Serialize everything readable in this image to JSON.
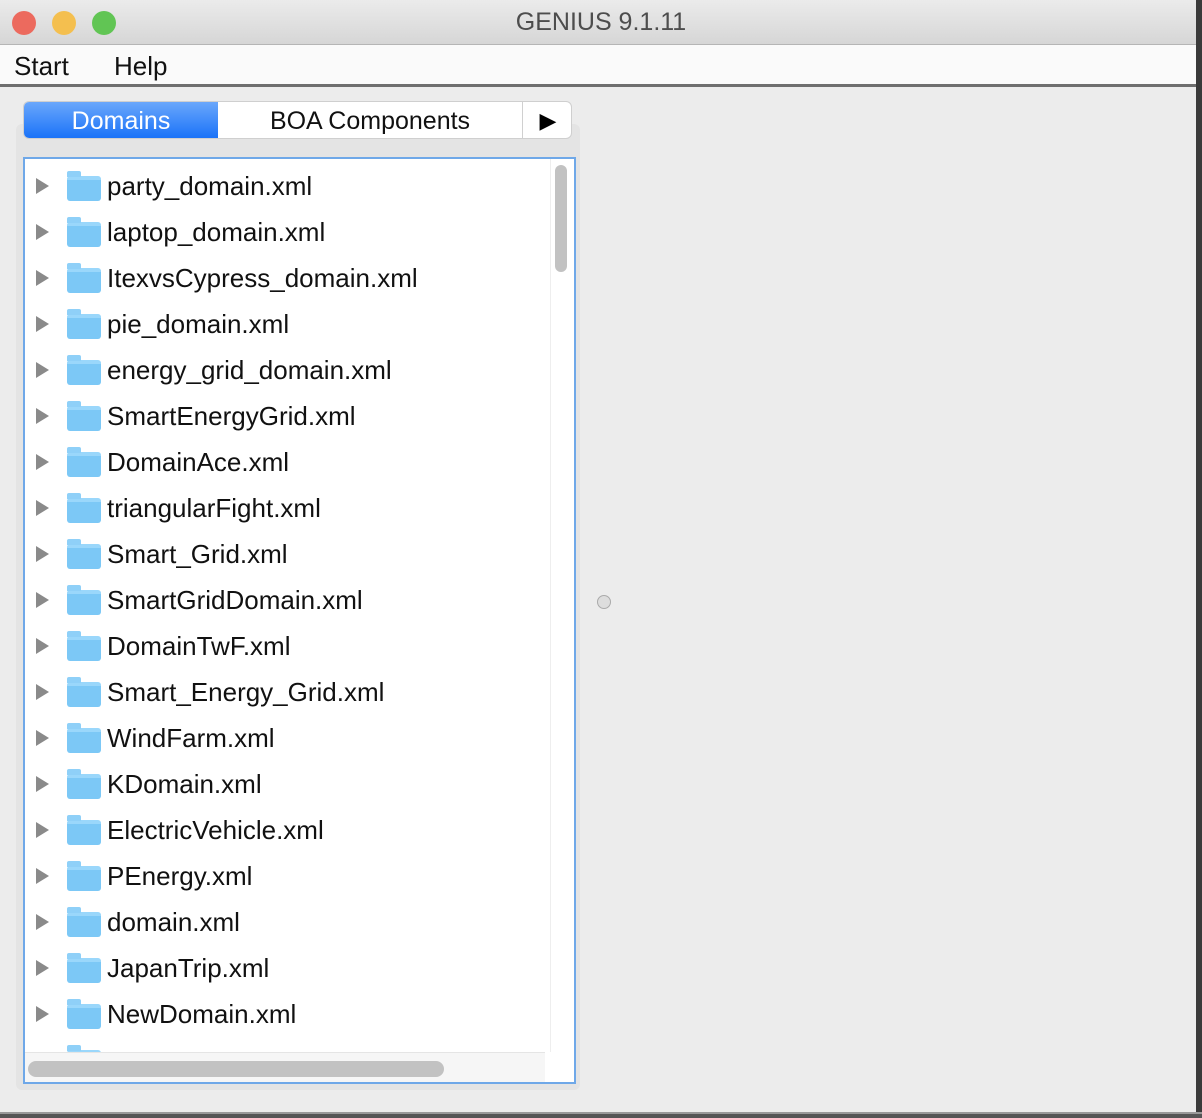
{
  "window": {
    "title": "GENIUS 9.1.11"
  },
  "menu": [
    "Start",
    "Help"
  ],
  "tabs": {
    "items": [
      "Domains",
      "BOA Components"
    ],
    "active": "Domains",
    "more_icon": "play-arrow-icon"
  },
  "colors": {
    "accent": "#2a7ef9",
    "close": "#ec6a5e",
    "minimize": "#f4bf4f",
    "zoom": "#61c554"
  },
  "tree": {
    "items": [
      "party_domain.xml",
      "laptop_domain.xml",
      "ItexvsCypress_domain.xml",
      "pie_domain.xml",
      "energy_grid_domain.xml",
      "SmartEnergyGrid.xml",
      "DomainAce.xml",
      "triangularFight.xml",
      "Smart_Grid.xml",
      "SmartGridDomain.xml",
      "DomainTwF.xml",
      "Smart_Energy_Grid.xml",
      "WindFarm.xml",
      "KDomain.xml",
      "ElectricVehicle.xml",
      "PEnergy.xml",
      "domain.xml",
      "JapanTrip.xml",
      "NewDomain.xml"
    ]
  }
}
